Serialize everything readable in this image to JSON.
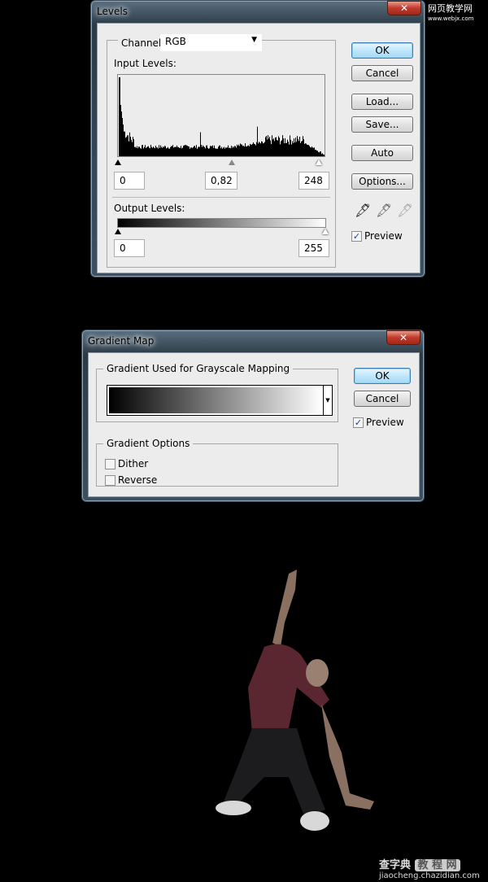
{
  "watermark_top": "网页教学网 www.webjx.com",
  "watermark_bottom": {
    "brand": "查字典 教程网",
    "url": "jiaocheng.chazidian.com"
  },
  "levels": {
    "title": "Levels",
    "close_icon": "close-icon",
    "channel_label": "Channel:",
    "channel_value": "RGB",
    "input_levels_label": "Input Levels:",
    "input_black": "0",
    "input_gamma": "0,82",
    "input_white": "248",
    "output_levels_label": "Output Levels:",
    "output_black": "0",
    "output_white": "255",
    "buttons": {
      "ok": "OK",
      "cancel": "Cancel",
      "load": "Load...",
      "save": "Save...",
      "auto": "Auto",
      "options": "Options..."
    },
    "eyedroppers": [
      "black-eyedropper-icon",
      "gray-eyedropper-icon",
      "white-eyedropper-icon"
    ],
    "preview_label": "Preview",
    "preview_checked": true
  },
  "gradient_map": {
    "title": "Gradient Map",
    "group_label": "Gradient Used for Grayscale Mapping",
    "gradient_colors": [
      "#000000",
      "#ffffff"
    ],
    "options_label": "Gradient Options",
    "dither_label": "Dither",
    "dither_checked": false,
    "reverse_label": "Reverse",
    "reverse_checked": false,
    "buttons": {
      "ok": "OK",
      "cancel": "Cancel"
    },
    "preview_label": "Preview",
    "preview_checked": true
  }
}
